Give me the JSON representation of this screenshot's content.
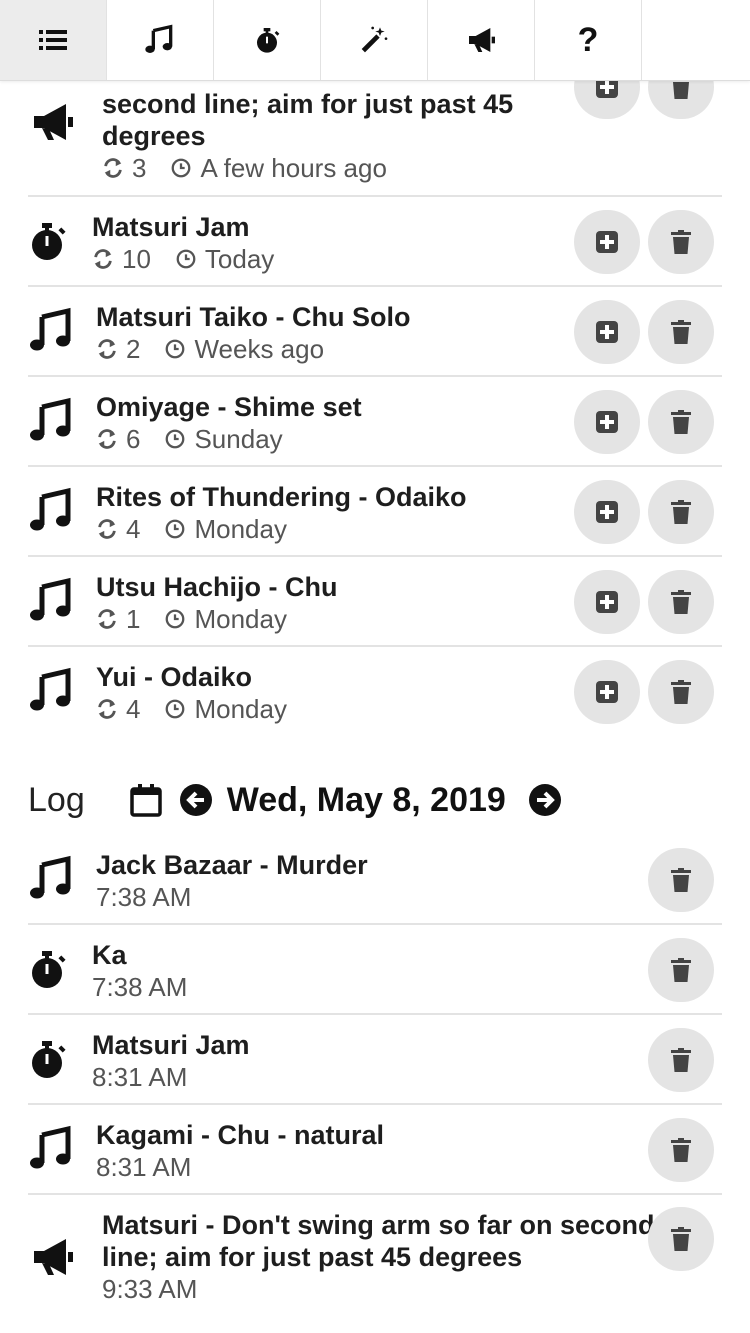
{
  "tabs": [
    {
      "name": "list-icon"
    },
    {
      "name": "music-note-icon"
    },
    {
      "name": "stopwatch-icon"
    },
    {
      "name": "magic-wand-icon"
    },
    {
      "name": "megaphone-icon"
    },
    {
      "name": "help-icon",
      "glyph": "?"
    }
  ],
  "routines": [
    {
      "icon": "megaphone-icon",
      "title_line1": "second line; aim for just past 45",
      "title_line2": "degrees",
      "count": "3",
      "last": "A few hours ago"
    },
    {
      "icon": "stopwatch-icon",
      "title": "Matsuri Jam",
      "count": "10",
      "last": "Today"
    },
    {
      "icon": "music-note-icon",
      "title": "Matsuri Taiko - Chu Solo",
      "count": "2",
      "last": "Weeks ago"
    },
    {
      "icon": "music-note-icon",
      "title": "Omiyage - Shime set",
      "count": "6",
      "last": "Sunday"
    },
    {
      "icon": "music-note-icon",
      "title": "Rites of Thundering - Odaiko",
      "count": "4",
      "last": "Monday"
    },
    {
      "icon": "music-note-icon",
      "title": "Utsu Hachijo - Chu",
      "count": "1",
      "last": "Monday"
    },
    {
      "icon": "music-note-icon",
      "title": "Yui - Odaiko",
      "count": "4",
      "last": "Monday"
    }
  ],
  "log": {
    "label": "Log",
    "date": "Wed, May 8, 2019",
    "entries": [
      {
        "icon": "music-note-icon",
        "title": "Jack Bazaar - Murder",
        "time": "7:38 AM"
      },
      {
        "icon": "stopwatch-icon",
        "title": "Ka",
        "time": "7:38 AM"
      },
      {
        "icon": "stopwatch-icon",
        "title": "Matsuri Jam",
        "time": "8:31 AM"
      },
      {
        "icon": "music-note-icon",
        "title": "Kagami - Chu - natural",
        "time": "8:31 AM"
      },
      {
        "icon": "megaphone-icon",
        "title_line1": "Matsuri - Don't swing arm so far on second",
        "title_line2": "line; aim for just past 45 degrees",
        "time": "9:33 AM"
      }
    ]
  }
}
